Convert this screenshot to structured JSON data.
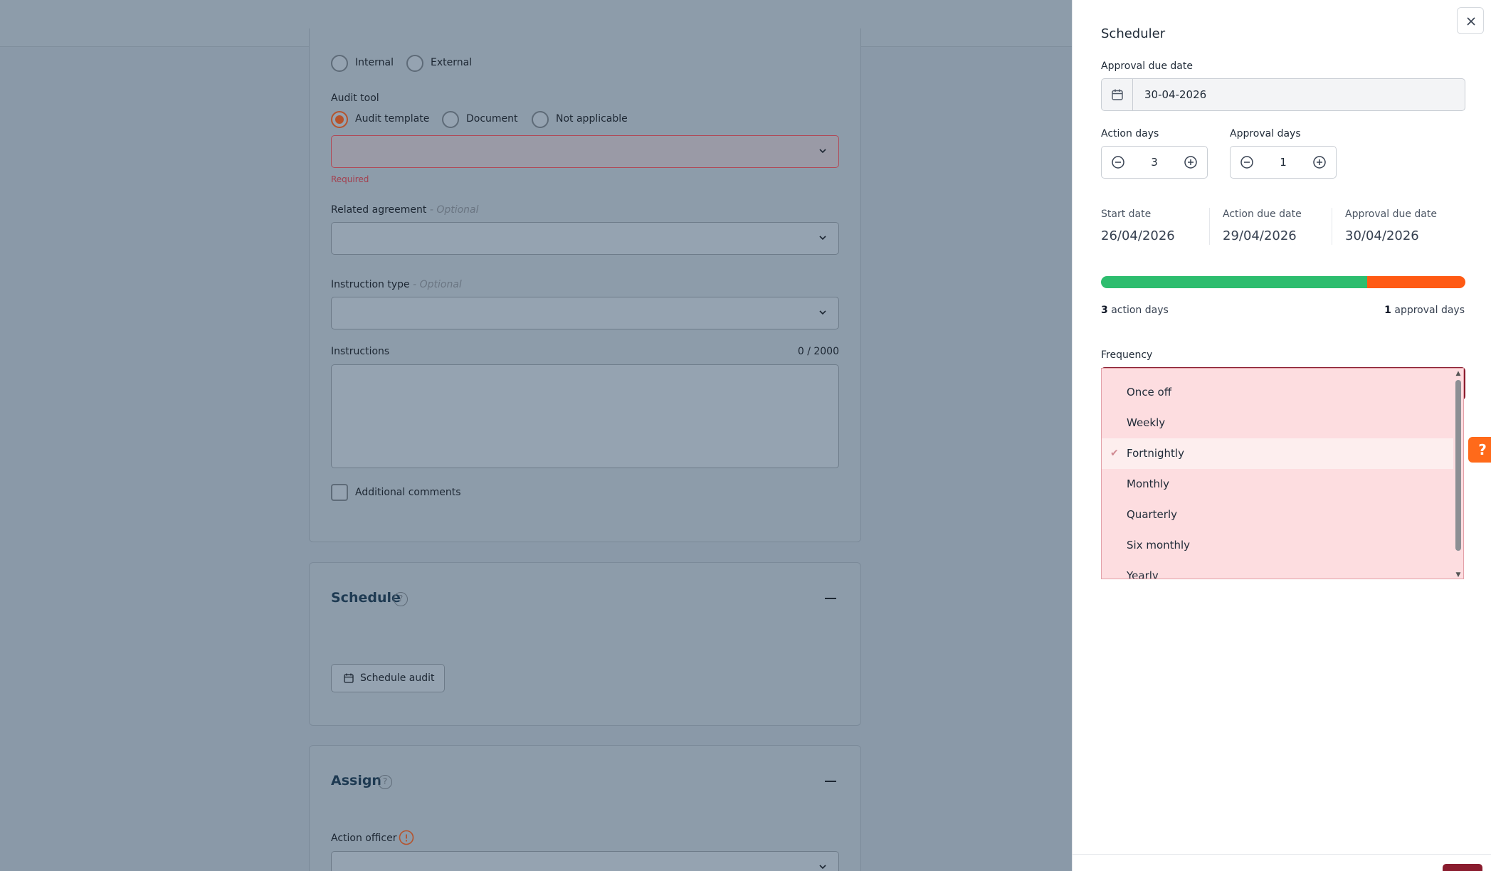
{
  "form": {
    "audit_type_options": [
      "Internal",
      "External"
    ],
    "audit_tool": {
      "label": "Audit tool",
      "options": [
        "Audit template",
        "Document",
        "Not applicable"
      ],
      "selected": "Audit template",
      "required_text": "Required"
    },
    "related_agreement": {
      "label": "Related agreement",
      "optional": "- Optional"
    },
    "instruction_type": {
      "label": "Instruction type",
      "optional": "- Optional"
    },
    "instructions": {
      "label": "Instructions",
      "counter": "0 / 2000"
    },
    "additional_comments": "Additional comments",
    "schedule": {
      "title": "Schedule",
      "help": "?",
      "button": "Schedule audit"
    },
    "assign": {
      "title": "Assign",
      "help": "?",
      "action_officer": "Action officer"
    }
  },
  "scheduler": {
    "title": "Scheduler",
    "approval_due_date_label": "Approval due date",
    "approval_due_date_value": "30-04-2026",
    "action_days_label": "Action days",
    "action_days_value": "3",
    "approval_days_label": "Approval days",
    "approval_days_value": "1",
    "summary": {
      "start_date_label": "Start date",
      "start_date": "26/04/2026",
      "action_due_label": "Action due date",
      "action_due": "29/04/2026",
      "approval_due_label": "Approval due date",
      "approval_due": "30/04/2026"
    },
    "timeline": {
      "action_days_count": "3",
      "action_days_text": "action days",
      "approval_days_count": "1",
      "approval_days_text": "approval days",
      "action_fraction": 0.73,
      "colors": {
        "action": "#2dbd6e",
        "approval": "#ff5a14"
      }
    },
    "frequency": {
      "label": "Frequency",
      "options": [
        "Once off",
        "Weekly",
        "Fortnightly",
        "Monthly",
        "Quarterly",
        "Six monthly",
        "Yearly"
      ],
      "selected": "Fortnightly"
    }
  },
  "help_tab": "?",
  "colors": {
    "brand": "#8a1c2e",
    "accent_orange": "#ff6a1a",
    "radio_selected": "#b5532c"
  }
}
